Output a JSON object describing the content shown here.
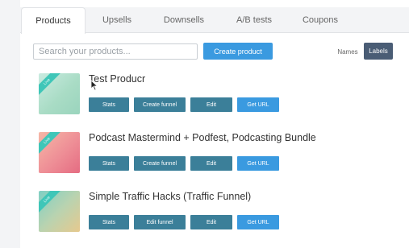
{
  "tabs": [
    {
      "label": "Products",
      "active": true
    },
    {
      "label": "Upsells",
      "active": false
    },
    {
      "label": "Downsells",
      "active": false
    },
    {
      "label": "A/B tests",
      "active": false
    },
    {
      "label": "Coupons",
      "active": false
    }
  ],
  "toolbar": {
    "search_placeholder": "Search your products...",
    "create_label": "Create product",
    "names_label": "Names",
    "labels_label": "Labels",
    "active_view": "Labels"
  },
  "colors": {
    "accent": "#3a9ae0",
    "action": "#3b7f99",
    "toggle_active": "#4a5d75",
    "ribbon": "#3fc6b8"
  },
  "products": [
    {
      "title": "Test Producr",
      "ribbon": "Live",
      "actions": [
        "Stats",
        "Create funnel",
        "Edit",
        "Get URL"
      ]
    },
    {
      "title": "Podcast Mastermind + Podfest, Podcasting Bundle",
      "ribbon": "Live",
      "actions": [
        "Stats",
        "Create funnel",
        "Edit",
        "Get URL"
      ]
    },
    {
      "title": "Simple Traffic Hacks (Traffic Funnel)",
      "ribbon": "Live",
      "actions": [
        "Stats",
        "Edit funnel",
        "Edit",
        "Get URL"
      ]
    }
  ]
}
